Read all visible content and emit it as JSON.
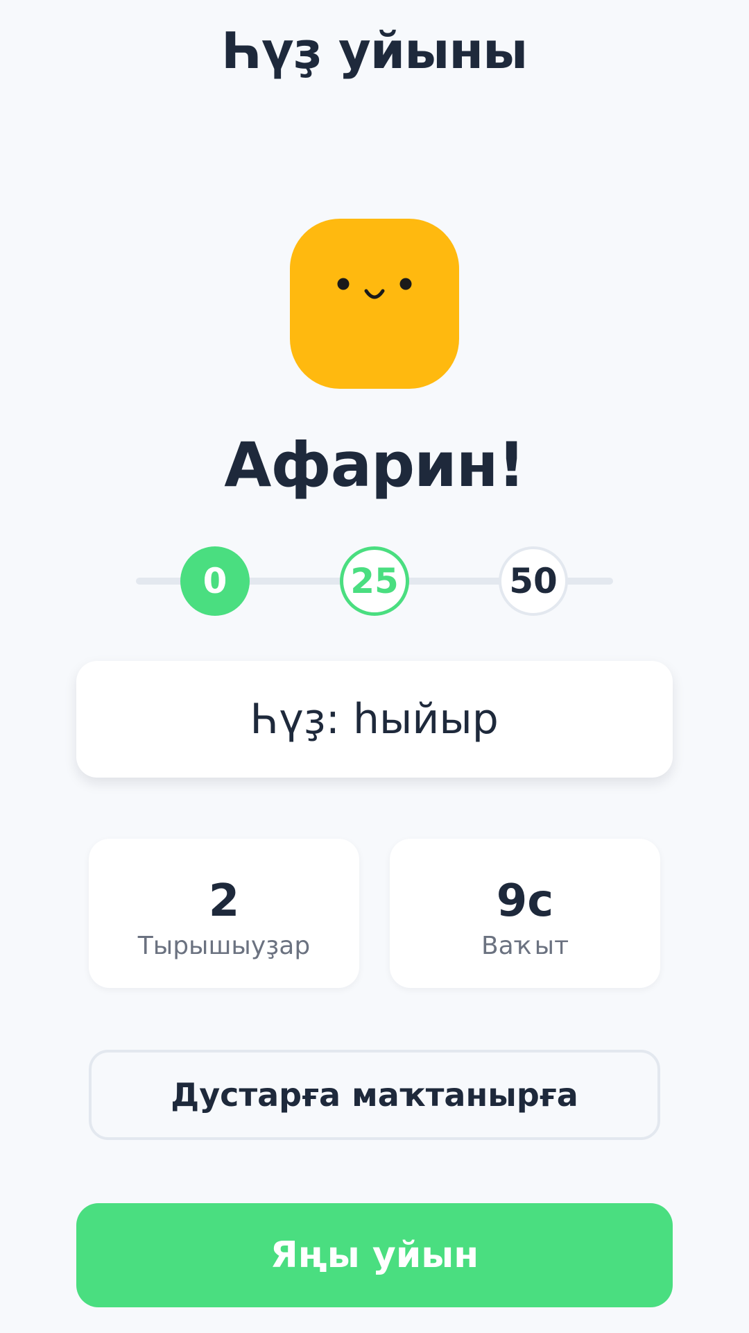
{
  "header": {
    "title": "Һүҙ уйыны"
  },
  "mascot": {
    "icon": "smiley-face-icon",
    "color": "#ffb90f"
  },
  "result": {
    "headline": "Афарин!"
  },
  "score_progress": {
    "steps": [
      "0",
      "25",
      "50"
    ],
    "current_step": "0",
    "active_color": "#4ade80"
  },
  "word_card": {
    "text": "Һүҙ: һыйыр"
  },
  "stats": {
    "attempts": {
      "value": "2",
      "label": "Тырышыуҙар"
    },
    "time": {
      "value": "9с",
      "label": "Ваҡыт"
    }
  },
  "actions": {
    "share_label": "Дустарға маҡтанырға",
    "new_game_label": "Яңы уйын",
    "new_game_color": "#4ade80"
  }
}
